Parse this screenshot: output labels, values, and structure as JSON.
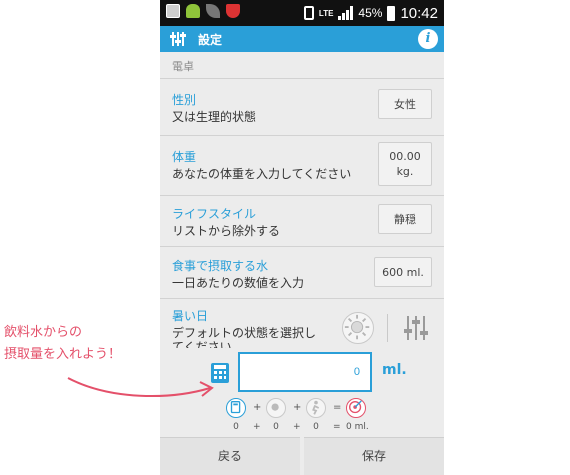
{
  "status_bar": {
    "network": "LTE",
    "battery": "45%",
    "time": "10:42"
  },
  "action_bar": {
    "title": "設定",
    "info_label": "i"
  },
  "section": "電卓",
  "rows": [
    {
      "label": "性別",
      "desc": "又は生理的状態",
      "value": "女性"
    },
    {
      "label": "体重",
      "desc": "あなたの体重を入力してください",
      "value_line1": "00.00",
      "value_line2": "kg."
    },
    {
      "label": "ライフスタイル",
      "desc": "リストから除外する",
      "value": "静穏"
    },
    {
      "label": "食事で摂取する水",
      "desc": "一日あたりの数値を入力",
      "value": "600 ml."
    },
    {
      "label": "暑い日",
      "desc_line1": "デフォルトの状態を選択し",
      "desc_line2": "てください"
    }
  ],
  "total": {
    "value": "0",
    "unit": "ml."
  },
  "formula": {
    "op_plus": "+",
    "op_equals": "=",
    "values": [
      "0",
      "0",
      "0"
    ],
    "result": "0 ml."
  },
  "buttons": {
    "back": "戻る",
    "save": "保存"
  },
  "annotation": {
    "line1": "飲料水からの",
    "line2": "摂取量を入れよう！"
  },
  "colors": {
    "accent": "#2a9fd8",
    "annotation": "#e4506a",
    "background": "#ececec"
  }
}
